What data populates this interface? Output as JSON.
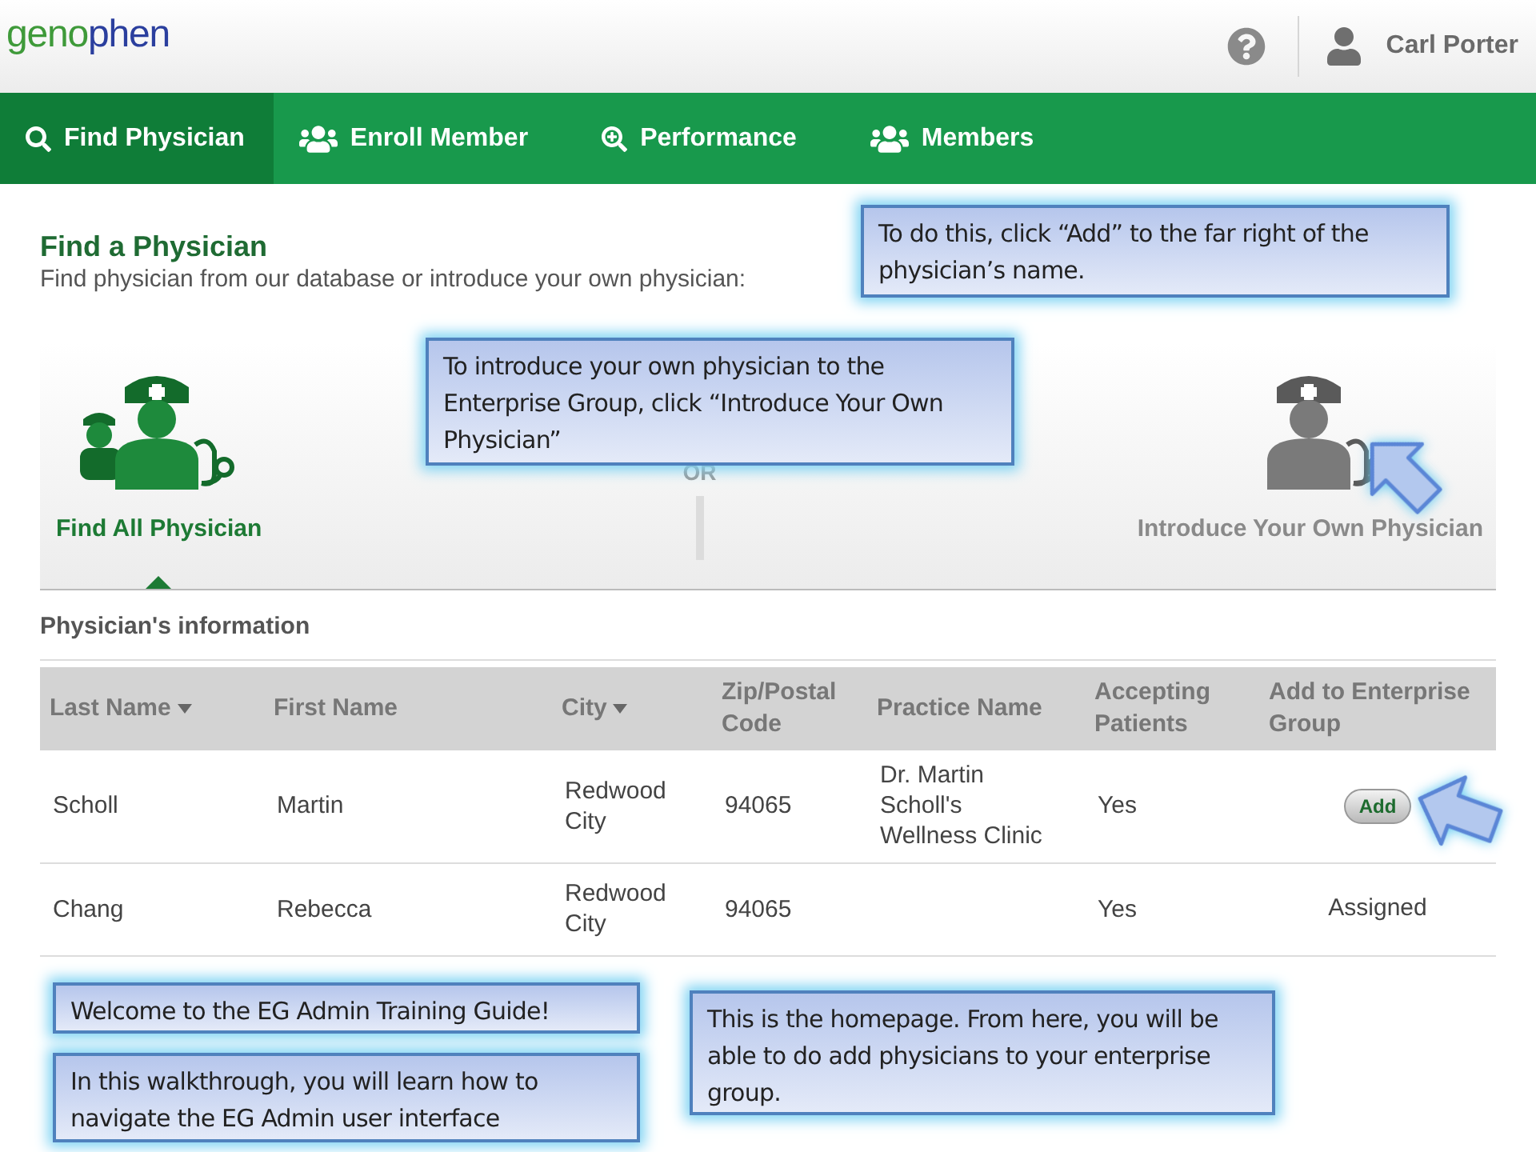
{
  "header": {
    "logo": [
      {
        "text": "geno",
        "color": "#3f9a3a"
      },
      {
        "text": "phen",
        "color": "#2b3f9e"
      }
    ],
    "user": "Carl Porter"
  },
  "nav": [
    {
      "label": "Find Physician",
      "kind": "search",
      "selected": true
    },
    {
      "label": "Enroll Member",
      "kind": "people",
      "selected": false
    },
    {
      "label": "Performance",
      "kind": "performance",
      "selected": false
    },
    {
      "label": "Members",
      "kind": "people",
      "selected": false
    }
  ],
  "page": {
    "title": "Find a Physician",
    "subtitle": "Find physician from our database or introduce your own physician:"
  },
  "options": [
    {
      "label": "Find All Physician",
      "selected": true
    },
    {
      "label": "Introduce Your Own Physician",
      "selected": false
    }
  ],
  "divider_label": "OR",
  "table": {
    "title": "Physician's information",
    "columns": [
      {
        "label": "Last Name",
        "sortable": true
      },
      {
        "label": "First Name",
        "sortable": false
      },
      {
        "label": "City",
        "sortable": true
      },
      {
        "label": "Zip/Postal Code",
        "sortable": false
      },
      {
        "label": "Practice Name",
        "sortable": false
      },
      {
        "label": "Accepting Patients",
        "sortable": false
      },
      {
        "label": "Add to Enterprise Group",
        "sortable": false
      }
    ],
    "rows": [
      {
        "cells": [
          "Scholl",
          "Martin",
          "Redwood City",
          "94065",
          "Dr. Martin Scholl's Wellness Clinic",
          "Yes"
        ],
        "action": {
          "kind": "button",
          "label": "Add"
        }
      },
      {
        "cells": [
          "Chang",
          "Rebecca",
          "Redwood City",
          "94065",
          "",
          "Yes"
        ],
        "action": {
          "kind": "text",
          "label": "Assigned"
        }
      }
    ]
  },
  "callouts": [
    {
      "text": "To do this, click “Add” to the far right of the physician’s name."
    },
    {
      "text": "To introduce your own physician to the Enterprise Group, click “Introduce Your Own Physician”"
    },
    {
      "text": "Welcome to the EG Admin Training Guide!"
    },
    {
      "text": "In this walkthrough, you will learn how to navigate the EG Admin user interface"
    },
    {
      "text": "This is the homepage. From here, you will be able to do add physicians to your enterprise group."
    }
  ]
}
